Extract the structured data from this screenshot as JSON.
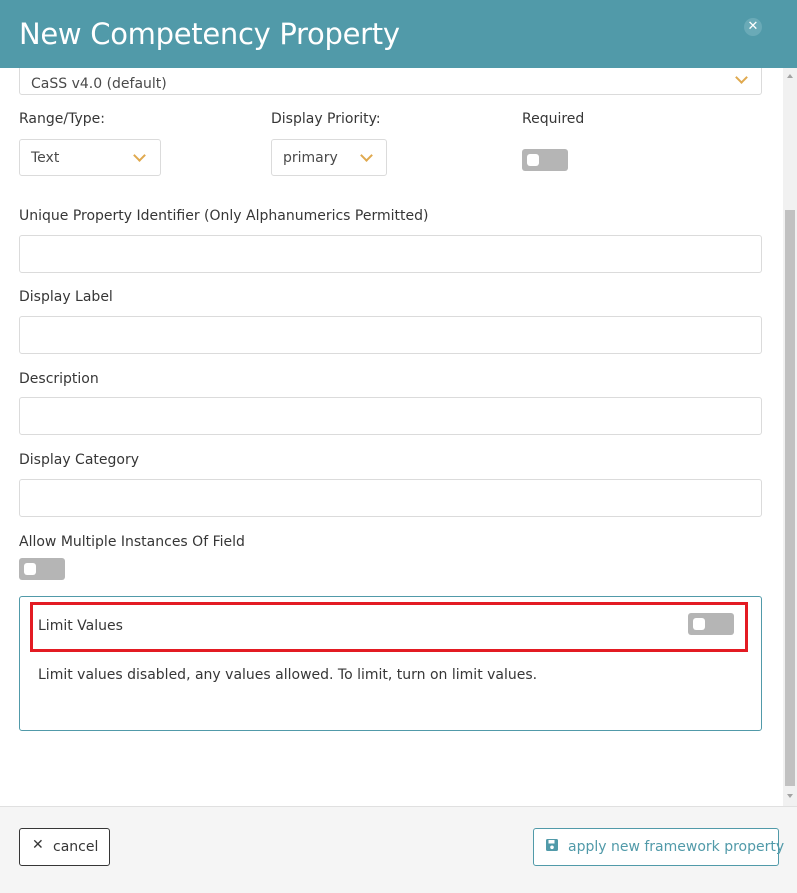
{
  "header": {
    "title": "New Competency Property"
  },
  "schema_select": {
    "value": "CaSS v4.0 (default)"
  },
  "range_type": {
    "label": "Range/Type:",
    "value": "Text"
  },
  "display_priority": {
    "label": "Display Priority:",
    "value": "primary"
  },
  "required": {
    "label": "Required",
    "on": false
  },
  "fields": {
    "unique_id_label": "Unique Property Identifier (Only Alphanumerics Permitted)",
    "display_label": "Display Label",
    "description": "Description",
    "display_category": "Display Category"
  },
  "allow_multiple": {
    "label": "Allow Multiple Instances Of Field",
    "on": false
  },
  "limit_values": {
    "label": "Limit Values",
    "on": false,
    "message": "Limit values disabled, any values allowed. To limit, turn on limit values."
  },
  "footer": {
    "cancel_label": "cancel",
    "apply_label": "apply new framework property"
  },
  "colors": {
    "header": "#519aa9",
    "accent": "#e0a94f",
    "highlight": "#e31b23"
  }
}
